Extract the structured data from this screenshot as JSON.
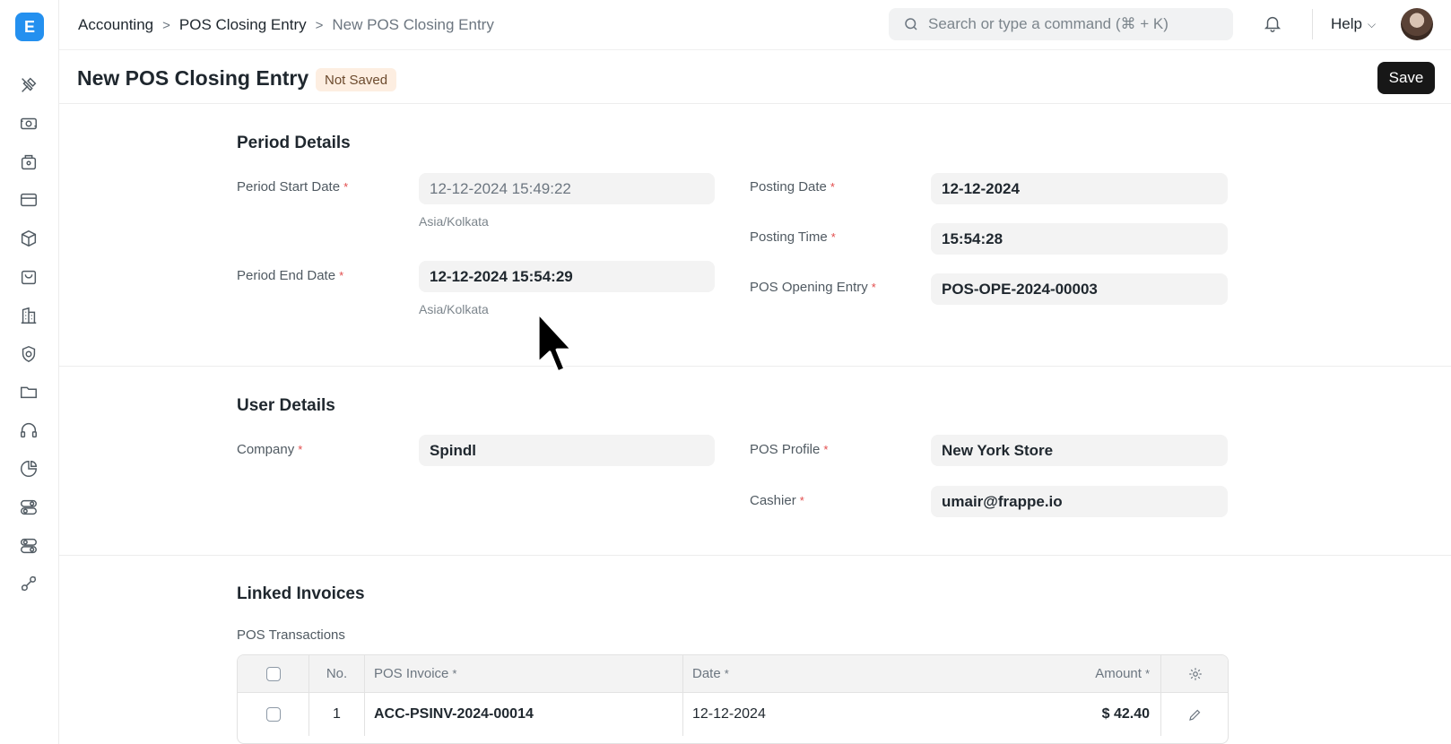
{
  "app": {
    "logo_letter": "E",
    "accent": "#2490ef"
  },
  "sidebar": {
    "icons": [
      "tools-icon",
      "money-icon",
      "pos-icon",
      "card-icon",
      "box-icon",
      "shopping-bag-icon",
      "building-icon",
      "shield-icon",
      "folder-icon",
      "headset-icon",
      "pie-chart-icon",
      "toggle-icon",
      "switch-icon",
      "integration-icon"
    ]
  },
  "navbar": {
    "breadcrumbs": [
      "Accounting",
      "POS Closing Entry",
      "New POS Closing Entry"
    ],
    "breadcrumb_sep": ">",
    "search_placeholder": "Search or type a command (⌘ + K)",
    "help_label": "Help"
  },
  "page": {
    "title": "New POS Closing Entry",
    "status": "Not Saved",
    "save_label": "Save"
  },
  "period": {
    "title": "Period Details",
    "start_label": "Period Start Date",
    "start_value": "12-12-2024 15:49:22",
    "start_tz": "Asia/Kolkata",
    "end_label": "Period End Date",
    "end_value": "12-12-2024 15:54:29",
    "end_tz": "Asia/Kolkata",
    "posting_date_label": "Posting Date",
    "posting_date_value": "12-12-2024",
    "posting_time_label": "Posting Time",
    "posting_time_value": "15:54:28",
    "opening_label": "POS Opening Entry",
    "opening_value": "POS-OPE-2024-00003"
  },
  "user": {
    "title": "User Details",
    "company_label": "Company",
    "company_value": "Spindl",
    "profile_label": "POS Profile",
    "profile_value": "New York Store",
    "cashier_label": "Cashier",
    "cashier_value": "umair@frappe.io"
  },
  "linked": {
    "title": "Linked Invoices",
    "table_label": "POS Transactions",
    "columns": {
      "no": "No.",
      "invoice": "POS Invoice",
      "date": "Date",
      "amount": "Amount"
    },
    "rows": [
      {
        "no": "1",
        "invoice": "ACC-PSINV-2024-00014",
        "date": "12-12-2024",
        "amount": "$ 42.40"
      }
    ]
  },
  "required_mark": "*"
}
